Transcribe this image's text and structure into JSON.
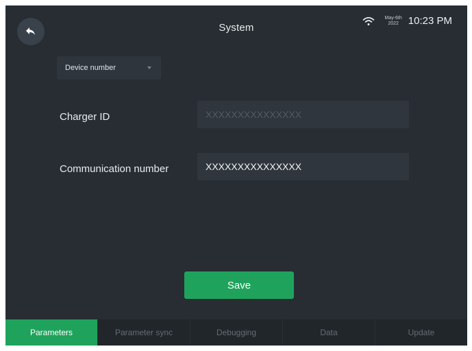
{
  "header": {
    "title": "System",
    "date_line1": "May-6th",
    "date_line2": "2022",
    "time": "10:23 PM",
    "back_icon": "back-arrow-icon",
    "wifi_icon": "wifi-icon"
  },
  "dropdown": {
    "selected": "Device number"
  },
  "form": {
    "charger_id": {
      "label": "Charger ID",
      "value": "",
      "placeholder": "XXXXXXXXXXXXXXX"
    },
    "communication_number": {
      "label": "Communication number",
      "value": "XXXXXXXXXXXXXXX"
    }
  },
  "actions": {
    "save_label": "Save"
  },
  "tabs": [
    {
      "label": "Parameters",
      "active": true
    },
    {
      "label": "Parameter sync",
      "active": false
    },
    {
      "label": "Debugging",
      "active": false
    },
    {
      "label": "Data",
      "active": false
    },
    {
      "label": "Update",
      "active": false
    }
  ],
  "colors": {
    "accent": "#1fa35c",
    "background": "#272d33"
  }
}
